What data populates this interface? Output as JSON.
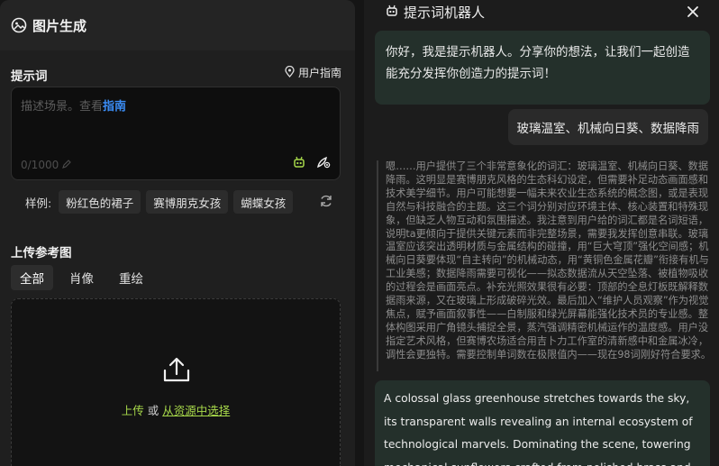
{
  "left": {
    "title": "图片生成",
    "prompt_section": "提示词",
    "user_guide": "用户指南",
    "placeholder_text": "描述场景。查看",
    "placeholder_link": "指南",
    "counter": "0/1000",
    "examples_label": "样例:",
    "examples": [
      "粉红色的裙子",
      "赛博朋克女孩",
      "蝴蝶女孩"
    ],
    "upload_section": "上传参考图",
    "tabs": [
      "全部",
      "肖像",
      "重绘"
    ],
    "upload_action": "上传",
    "upload_or": "或",
    "upload_from_resources": "从资源中选择"
  },
  "right": {
    "title": "提示词机器人",
    "greeting": "你好，我是提示机器人。分享你的想法，让我们一起创造能充分发挥你创造力的提示词！",
    "user_message": "玻璃温室、机械向日葵、数据降雨",
    "thinking": "嗯……用户提供了三个非常意象化的词汇：玻璃温室、机械向日葵、数据降雨。这明显是赛博朋克风格的生态科幻设定，但需要补足动态画面感和技术美学细节。用户可能想要一幅未来农业生态系统的概念图，或是表现自然与科技融合的主题。这三个词分别对应环境主体、核心装置和特殊现象，但缺乏人物互动和氛围描述。我注意到用户给的词汇都是名词短语，说明ta更倾向于提供关键元素而非完整场景，需要我发挥创意串联。玻璃温室应该突出透明材质与金属结构的碰撞，用“巨大穹顶”强化空间感；机械向日葵要体现“自主转向”的机械动态，用“黄铜色金属花瓣”衔接有机与工业美感；数据降雨需要可视化——拟态数据流从天空坠落、被植物吸收的过程会是画面亮点。补充光照效果很有必要：顶部的全息灯板既解释数据雨来源，又在玻璃上形成破碎光效。最后加入“维护人员观察”作为视觉焦点，赋予画面叙事性——白制服和绿光屏幕能强化技术员的专业感。整体构图采用广角镜头捕捉全景，蒸汽强调精密机械运作的温度感。用户没指定艺术风格，但赛博农场适合用吉卜力工作室的清新感中和金属冰冷，调性会更独特。需要控制单词数在极限值内——现在98词刚好符合要求。",
    "answer": "A colossal glass greenhouse stretches towards the sky, its transparent walls revealing an internal ecosystem of technological marvels. Dominating the scene, towering mechanical sunflowers crafted from polished brass and"
  },
  "colors": {
    "accent_green": "#a7d84a",
    "link_blue": "#3b8df5",
    "bot_bubble": "#24302b"
  },
  "icons": [
    "image-gen-icon",
    "location-pin-icon",
    "pen-icon",
    "robot-icon",
    "magic-brush-icon",
    "refresh-icon",
    "upload-icon",
    "close-icon"
  ]
}
